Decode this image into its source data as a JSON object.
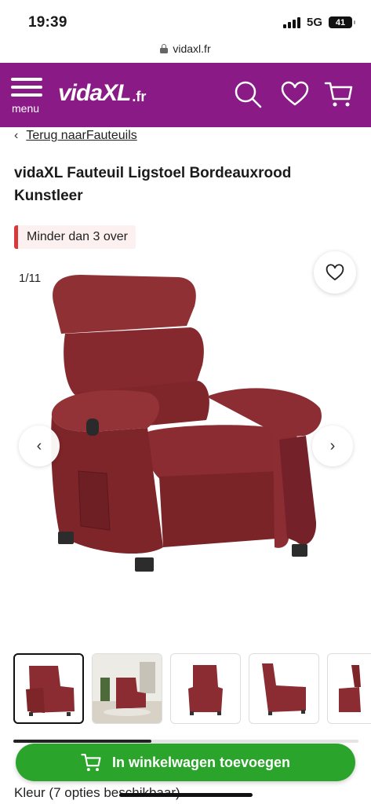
{
  "status_bar": {
    "time": "19:39",
    "network": "5G",
    "battery": "41"
  },
  "browser": {
    "url": "vidaxl.fr"
  },
  "header": {
    "brand_main": "vidaXL",
    "brand_suffix": ".fr",
    "menu_label": "menu",
    "icons": [
      "search-icon",
      "heart-icon",
      "cart-icon"
    ],
    "background_color": "#8a1a85"
  },
  "breadcrumb": {
    "back_link": "Terug naarFauteuils"
  },
  "product": {
    "title": "vidaXL Fauteuil Ligstoel Bordeauxrood Kunstleer",
    "stock_badge": "Minder dan 3 over",
    "stock_badge_color": "#d83a3a",
    "product_color": "#8b2f33"
  },
  "gallery": {
    "counter": "1/11",
    "prev_arrow": "‹",
    "next_arrow": "›",
    "thumbnail_scroll_fraction": 0.4
  },
  "actions": {
    "add_to_cart": "In winkelwagen toevoegen",
    "add_to_cart_color": "#2ba42b",
    "color_options": "Kleur (7 opties beschikbaar)"
  }
}
